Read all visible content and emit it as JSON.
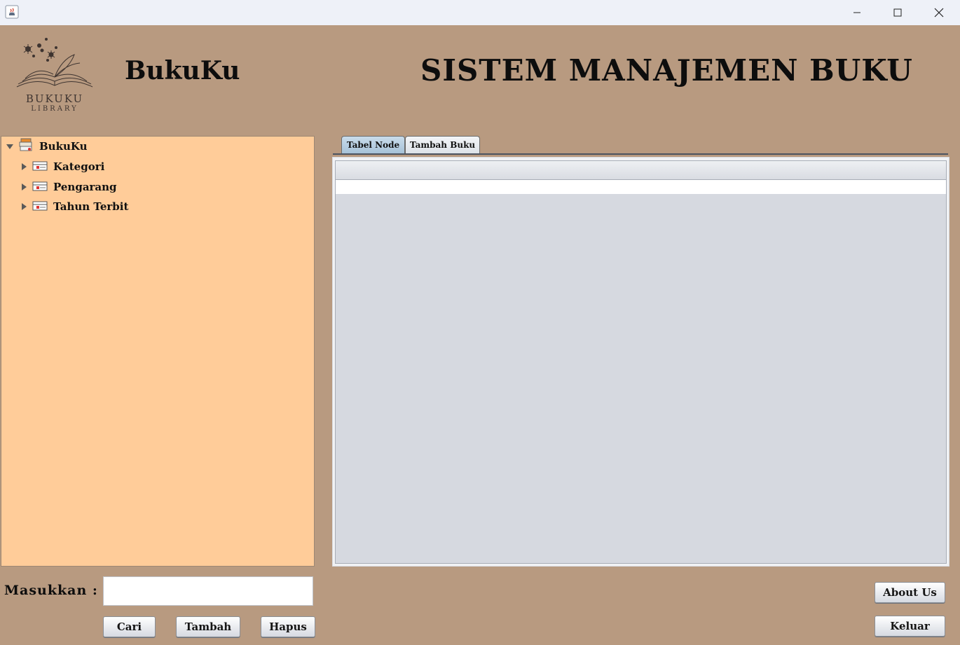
{
  "window": {
    "controls": [
      "minimize-icon",
      "maximize-icon",
      "close-icon"
    ]
  },
  "header": {
    "logo_line1": "BUKUKU",
    "logo_line2": "LIBRARY",
    "brand": "BukuKu",
    "title": "SISTEM MANAJEMEN BUKU"
  },
  "tree": {
    "root": "BukuKu",
    "children": [
      "Kategori",
      "Pengarang",
      "Tahun Terbit"
    ]
  },
  "tabs": [
    {
      "label": "Tabel Node",
      "active": true
    },
    {
      "label": "Tambah Buku",
      "active": false
    }
  ],
  "form": {
    "label": "Masukkan :",
    "value": "",
    "buttons": {
      "search": "Cari",
      "add": "Tambah",
      "delete": "Hapus"
    }
  },
  "side_buttons": {
    "about": "About Us",
    "exit": "Keluar"
  },
  "colors": {
    "background": "#b89a80",
    "tree_background": "#ffcc99",
    "table_background": "#d6d9e0",
    "active_tab": "#b9d0e3"
  }
}
